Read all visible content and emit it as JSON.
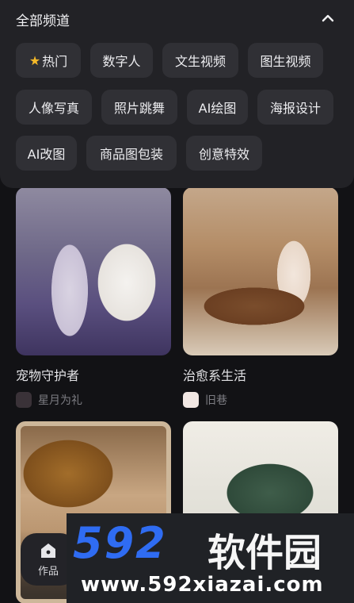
{
  "panel": {
    "title": "全部频道",
    "chips": [
      {
        "label": "热门",
        "has_star": true
      },
      {
        "label": "数字人"
      },
      {
        "label": "文生视频"
      },
      {
        "label": "图生视频"
      },
      {
        "label": "人像写真"
      },
      {
        "label": "照片跳舞"
      },
      {
        "label": "AI绘图"
      },
      {
        "label": "海报设计"
      },
      {
        "label": "AI改图"
      },
      {
        "label": "商品图包装"
      },
      {
        "label": "创意特效"
      }
    ]
  },
  "feed": {
    "cards": [
      {
        "title": "宠物守护者",
        "author": "星月为礼"
      },
      {
        "title": "治愈系生活",
        "author": "旧巷"
      },
      {
        "title": "",
        "author": ""
      },
      {
        "title": "",
        "author": ""
      }
    ]
  },
  "nav": {
    "label": "作品"
  },
  "watermark": {
    "brand": "592",
    "brand_cn": "软件园",
    "url": "www.592xiazai.com"
  },
  "colors": {
    "accent_star": "#f5b928",
    "panel_bg": "#222226",
    "chip_bg": "#303035",
    "watermark_blue": "#2f6cf2"
  }
}
